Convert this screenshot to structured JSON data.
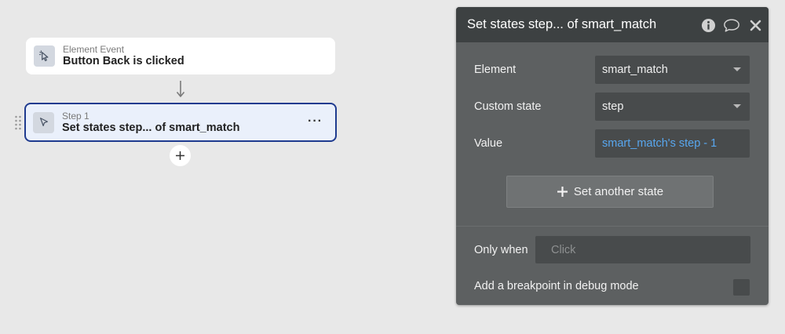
{
  "workflow": {
    "event": {
      "kicker": "Element Event",
      "title": "Button Back is clicked"
    },
    "step": {
      "kicker": "Step 1",
      "title": "Set states step... of smart_match",
      "more_label": "···"
    },
    "add_step_icon": "plus-icon"
  },
  "panel": {
    "title": "Set states step... of smart_match",
    "header_icons": [
      "info-icon",
      "comment-icon",
      "close-icon"
    ],
    "rows": {
      "element": {
        "label": "Element",
        "value": "smart_match"
      },
      "custom_state": {
        "label": "Custom state",
        "value": "step"
      },
      "value": {
        "label": "Value",
        "value": "smart_match's step - 1"
      }
    },
    "set_another_state_label": "Set another state",
    "only_when": {
      "label": "Only when",
      "placeholder": "Click"
    },
    "breakpoint_label": "Add a breakpoint in debug mode"
  },
  "colors": {
    "canvas_bg": "#e8e8e8",
    "step_border": "#1f3b8f",
    "step_bg": "#eaf0fb",
    "panel_bg": "#5d6061",
    "panel_header_bg": "#3d4142",
    "dynamic_value": "#58a7ef"
  }
}
